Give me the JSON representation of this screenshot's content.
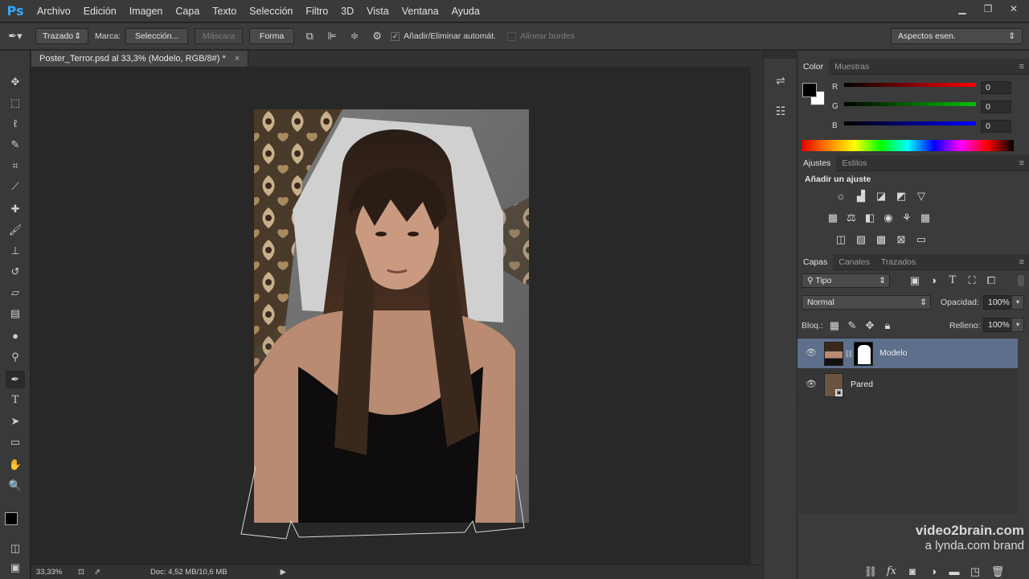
{
  "app": {
    "logo": "Ps"
  },
  "menu": [
    "Archivo",
    "Edición",
    "Imagen",
    "Capa",
    "Texto",
    "Selección",
    "Filtro",
    "3D",
    "Vista",
    "Ventana",
    "Ayuda"
  ],
  "options": {
    "mode": "Trazado",
    "marca_label": "Marca:",
    "seleccion": "Selección...",
    "mascara": "Máscara",
    "forma": "Forma",
    "auto_add": "Añadir/Eliminar automát.",
    "align_edges": "Alinear bordes",
    "workspace": "Aspectos esen."
  },
  "document": {
    "tab_title": "Poster_Terror.psd al 33,3% (Modelo, RGB/8#) *",
    "zoom": "33,33%",
    "doc_info": "Doc: 4,52 MB/10,6 MB"
  },
  "color_panel": {
    "tabs": [
      "Color",
      "Muestras"
    ],
    "channels": [
      {
        "label": "R",
        "value": "0",
        "color": "#ff0000"
      },
      {
        "label": "G",
        "value": "0",
        "color": "#00c000"
      },
      {
        "label": "B",
        "value": "0",
        "color": "#0000ff"
      }
    ]
  },
  "adjustments_panel": {
    "tabs": [
      "Ajustes",
      "Estilos"
    ],
    "heading": "Añadir un ajuste"
  },
  "layers_panel": {
    "tabs": [
      "Capas",
      "Canales",
      "Trazados"
    ],
    "filter_kind": "Tipo",
    "blend_mode": "Normal",
    "opacity_label": "Opacidad:",
    "opacity": "100%",
    "lock_label": "Bloq.:",
    "fill_label": "Relleno:",
    "fill": "100%",
    "layers": [
      {
        "name": "Modelo",
        "selected": true
      },
      {
        "name": "Pared",
        "selected": false
      }
    ]
  },
  "watermark": {
    "line1": "video2brain.com",
    "line2": "a lynda.com brand"
  }
}
